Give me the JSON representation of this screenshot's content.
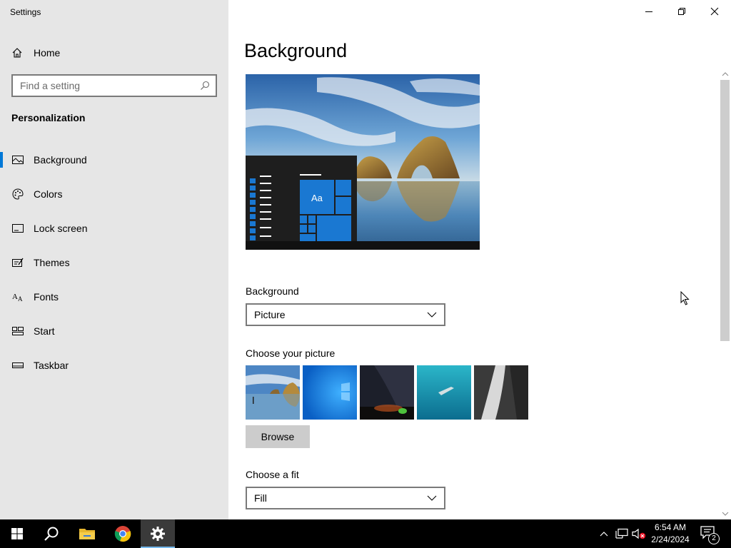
{
  "window": {
    "app_title": "Settings",
    "caption": {
      "minimize": "minimize-icon",
      "restore": "restore-icon",
      "close": "close-icon"
    }
  },
  "sidebar": {
    "home_label": "Home",
    "search_placeholder": "Find a setting",
    "section_title": "Personalization",
    "items": [
      {
        "label": "Background",
        "icon": "picture-icon",
        "active": true
      },
      {
        "label": "Colors",
        "icon": "palette-icon",
        "active": false
      },
      {
        "label": "Lock screen",
        "icon": "lock-screen-icon",
        "active": false
      },
      {
        "label": "Themes",
        "icon": "themes-icon",
        "active": false
      },
      {
        "label": "Fonts",
        "icon": "fonts-icon",
        "active": false
      },
      {
        "label": "Start",
        "icon": "start-icon",
        "active": false
      },
      {
        "label": "Taskbar",
        "icon": "taskbar-icon",
        "active": false
      }
    ]
  },
  "main": {
    "title": "Background",
    "preview": {
      "tile_text": "Aa"
    },
    "background_label": "Background",
    "background_value": "Picture",
    "choose_picture_label": "Choose your picture",
    "thumbnails": [
      "beach-rock",
      "windows-blue",
      "night-sky",
      "underwater-swimmer",
      "rock-waterfall"
    ],
    "browse_label": "Browse",
    "fit_label": "Choose a fit",
    "fit_value": "Fill"
  },
  "taskbar": {
    "pinned": [
      "start-icon",
      "search-icon",
      "file-explorer-icon",
      "chrome-icon",
      "settings-icon"
    ],
    "active_app": "settings-icon",
    "time": "6:54 AM",
    "date": "2/24/2024",
    "notification_count": "2"
  },
  "colors": {
    "accent": "#0078d7",
    "sidebar_bg": "#e6e6e6",
    "taskbar_bg": "#000000"
  }
}
